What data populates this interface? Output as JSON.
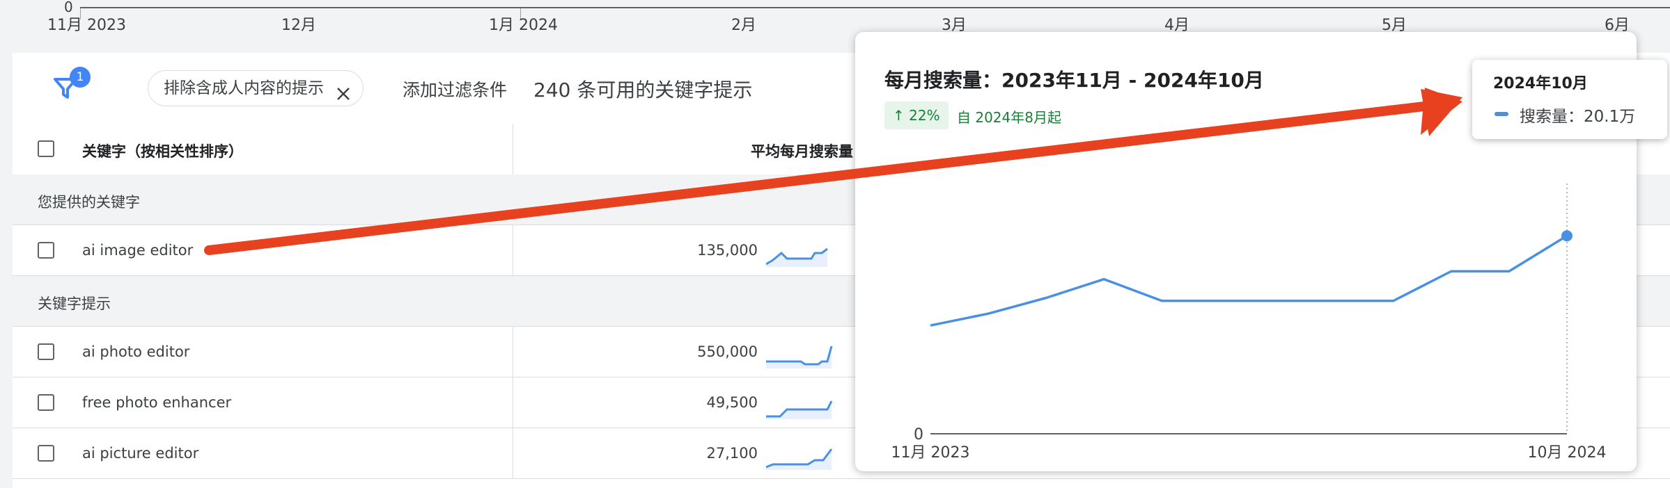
{
  "top_axis": {
    "zero_label": "0",
    "ticks": [
      "11月 2023",
      "12月",
      "1月 2024",
      "2月",
      "3月",
      "4月",
      "5月",
      "6月"
    ]
  },
  "filter_bar": {
    "filter_badge": "1",
    "chip_label": "排除含成人内容的提示",
    "add_filter": "添加过滤条件",
    "suggestion_count": "240 条可用的关键字提示"
  },
  "table": {
    "header_keyword": "关键字（按相关性排序）",
    "header_volume": "平均每月搜索量",
    "section_provided": "您提供的关键字",
    "section_suggestions": "关键字提示",
    "rows": [
      {
        "keyword": "ai image editor",
        "volume": "135,000"
      },
      {
        "keyword": "ai photo editor",
        "volume": "550,000"
      },
      {
        "keyword": "free photo enhancer",
        "volume": "49,500"
      },
      {
        "keyword": "ai picture editor",
        "volume": "27,100"
      }
    ]
  },
  "popup": {
    "title": "每月搜索量：2023年11月 - 2024年10月",
    "trend": "↑ 22%",
    "trend_since": "自 2024年8月起",
    "colors": {
      "line": "#4a90e2",
      "trend_bg": "#e6f4ea",
      "trend_text": "#188038",
      "arrow": "#e8411f"
    }
  },
  "tooltip": {
    "title": "2024年10月",
    "value": "搜索量：20.1万"
  },
  "chart_data": {
    "type": "line",
    "title": "每月搜索量：2023年11月 - 2024年10月",
    "x": [
      "2023-11",
      "2023-12",
      "2024-01",
      "2024-02",
      "2024-03",
      "2024-04",
      "2024-05",
      "2024-06",
      "2024-07",
      "2024-08",
      "2024-09",
      "2024-10"
    ],
    "x_tick_labels": [
      "11月 2023",
      "10月 2024"
    ],
    "y_tick_labels": [
      "0"
    ],
    "series": [
      {
        "values": [
          110000,
          122000,
          138000,
          157000,
          135000,
          135000,
          135000,
          135000,
          135000,
          165000,
          165000,
          201000
        ]
      }
    ],
    "ylim": [
      0,
      240000
    ],
    "grid": false,
    "legend": "none"
  }
}
